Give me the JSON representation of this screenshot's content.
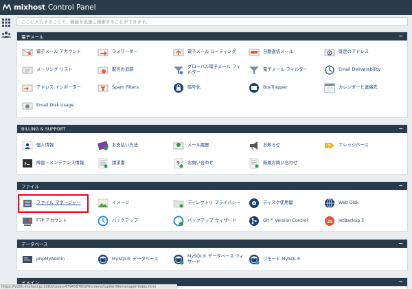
{
  "header": {
    "brand": "mixhost",
    "product": "Control Panel"
  },
  "search": {
    "placeholder": "ここに入力することで、機能を迅速に検索することができます。"
  },
  "colors": {
    "header_bg": "#293a4a",
    "link": "#1a3f73",
    "highlight": "#e8000c"
  },
  "sections": [
    {
      "title": "電子メール",
      "items": [
        {
          "label": "電子メール アカウント",
          "icon": "envelope-person-icon"
        },
        {
          "label": "フォワーダー",
          "icon": "forward-arrow-icon"
        },
        {
          "label": "電子メール ルーティング",
          "icon": "routing-icon"
        },
        {
          "label": "自動返信メール",
          "icon": "autoresponder-icon"
        },
        {
          "label": "既定のアドレス",
          "icon": "at-sign-icon"
        },
        {
          "label": "メーリング リスト",
          "icon": "mailing-list-icon"
        },
        {
          "label": "配信の追跡",
          "icon": "track-delivery-icon"
        },
        {
          "label": "グローバル電子メール フィルター",
          "icon": "global-filter-icon"
        },
        {
          "label": "電子メール フィルター",
          "icon": "filter-icon"
        },
        {
          "label": "Email Deliverability",
          "icon": "deliverability-icon"
        },
        {
          "label": "アドレス インポーター",
          "icon": "importer-icon"
        },
        {
          "label": "Spam Filters",
          "icon": "spam-filter-icon"
        },
        {
          "label": "暗号化",
          "icon": "encryption-icon"
        },
        {
          "label": "BoxTrapper",
          "icon": "boxtrapper-icon"
        },
        {
          "label": "カレンダーと連絡先",
          "icon": "calendar-icon"
        },
        {
          "label": "Email Disk Usage",
          "icon": "disk-usage-icon"
        }
      ]
    },
    {
      "title": "BILLING & SUPPORT",
      "items": [
        {
          "label": "個人情報",
          "icon": "personal-info-icon"
        },
        {
          "label": "お支払い方法",
          "icon": "payment-icon"
        },
        {
          "label": "メール履歴",
          "icon": "email-history-icon"
        },
        {
          "label": "お知らせ",
          "icon": "megaphone-icon"
        },
        {
          "label": "ナレッジベース",
          "icon": "knowledge-base-icon"
        },
        {
          "label": "障害・メンテナンス情報",
          "icon": "maintenance-icon"
        },
        {
          "label": "請求書",
          "icon": "invoice-icon"
        },
        {
          "label": "お問い合わせ",
          "icon": "contact-icon"
        },
        {
          "label": "新規お問い合わせ",
          "icon": "new-ticket-icon"
        }
      ]
    },
    {
      "title": "ファイル",
      "items": [
        {
          "label": "ファイル マネージャー",
          "icon": "file-manager-icon"
        },
        {
          "label": "イメージ",
          "icon": "images-icon"
        },
        {
          "label": "ディレクトリ プライバシー",
          "icon": "directory-privacy-icon"
        },
        {
          "label": "ディスク使用量",
          "icon": "disk-icon"
        },
        {
          "label": "Web Disk",
          "icon": "web-disk-icon"
        },
        {
          "label": "FTP アカウント",
          "icon": "ftp-icon"
        },
        {
          "label": "バックアップ",
          "icon": "backup-icon"
        },
        {
          "label": "バックアップ ウィザード",
          "icon": "backup-wizard-icon"
        },
        {
          "label": "Git™ Version Control",
          "icon": "git-icon"
        },
        {
          "label": "JetBackup 5",
          "icon": "jetbackup-icon"
        }
      ]
    },
    {
      "title": "データベース",
      "items": [
        {
          "label": "phpMyAdmin",
          "icon": "phpmyadmin-icon"
        },
        {
          "label": "MySQL® データベース",
          "icon": "mysql-icon"
        },
        {
          "label": "MySQL® データベース ウィザード",
          "icon": "mysql-wizard-icon"
        },
        {
          "label": "リモート MySQL®",
          "icon": "remote-mysql-icon"
        }
      ]
    },
    {
      "title": "ドメイン",
      "items": []
    }
  ],
  "statusbar": {
    "url": "https://lv200.mixhost.jp:2083/cpsess4794587809/frontend/jupiter/filemanager/index.html"
  }
}
